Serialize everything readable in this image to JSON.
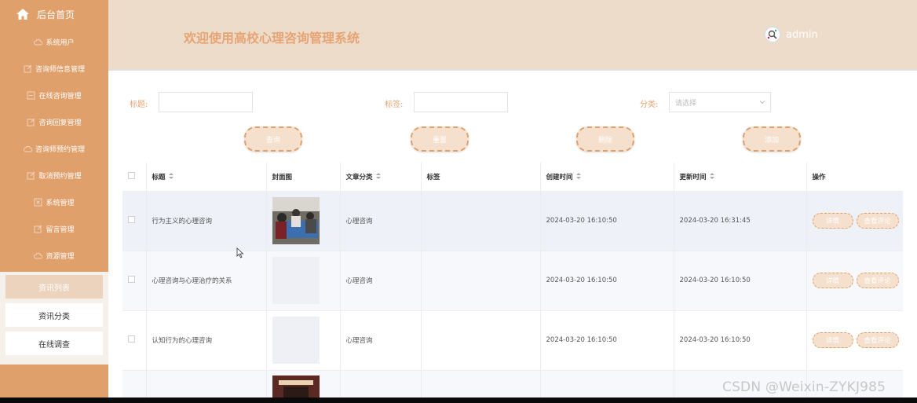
{
  "sidebar": {
    "home_label": "后台首页",
    "items": [
      {
        "label": "系统用户",
        "icon": "cloud-icon"
      },
      {
        "label": "咨询师信息管理",
        "icon": "edit-icon"
      },
      {
        "label": "在线咨询管理",
        "icon": "box-minus-icon"
      },
      {
        "label": "咨询回复管理",
        "icon": "edit-icon"
      },
      {
        "label": "咨询师预约管理",
        "icon": "cloud-icon"
      },
      {
        "label": "取消预约管理",
        "icon": "edit-icon"
      },
      {
        "label": "系统管理",
        "icon": "box-x-icon"
      },
      {
        "label": "留言管理",
        "icon": "edit-icon"
      },
      {
        "label": "资源管理",
        "icon": "cloud-icon"
      }
    ],
    "submenu": [
      "资讯列表",
      "资讯分类",
      "在线调查"
    ]
  },
  "header": {
    "title": "欢迎使用高校心理咨询管理系统",
    "username": "admin"
  },
  "filters": {
    "title_label": "标题:",
    "tag_label": "标签:",
    "category_label": "分类:",
    "category_placeholder": "请选择"
  },
  "buttons": {
    "search": "查询",
    "reset": "重置",
    "delete": "删除",
    "add": "添加"
  },
  "table": {
    "headers": [
      "标题",
      "封面图",
      "文章分类",
      "标签",
      "创建时间",
      "更新时间",
      "操作"
    ],
    "row_actions": [
      "详情",
      "查看评论"
    ],
    "rows": [
      {
        "title": "行为主义的心理咨询",
        "category": "心理咨询",
        "tag": "",
        "created": "2024-03-20 16:10:50",
        "updated": "2024-03-20 16:31:45"
      },
      {
        "title": "心理咨询与心理治疗的关系",
        "category": "心理咨询",
        "tag": "",
        "created": "2024-03-20 16:10:50",
        "updated": "2024-03-20 16:10:50"
      },
      {
        "title": "认知行为的心理咨询",
        "category": "心理咨询",
        "tag": "",
        "created": "2024-03-20 16:10:50",
        "updated": "2024-03-20 16:10:50"
      }
    ]
  },
  "watermark": "CSDN @Weixin-ZYKJ985",
  "colors": {
    "accent": "#e0a06c",
    "header_bg": "#eedccb",
    "title_color": "#e6a474"
  }
}
